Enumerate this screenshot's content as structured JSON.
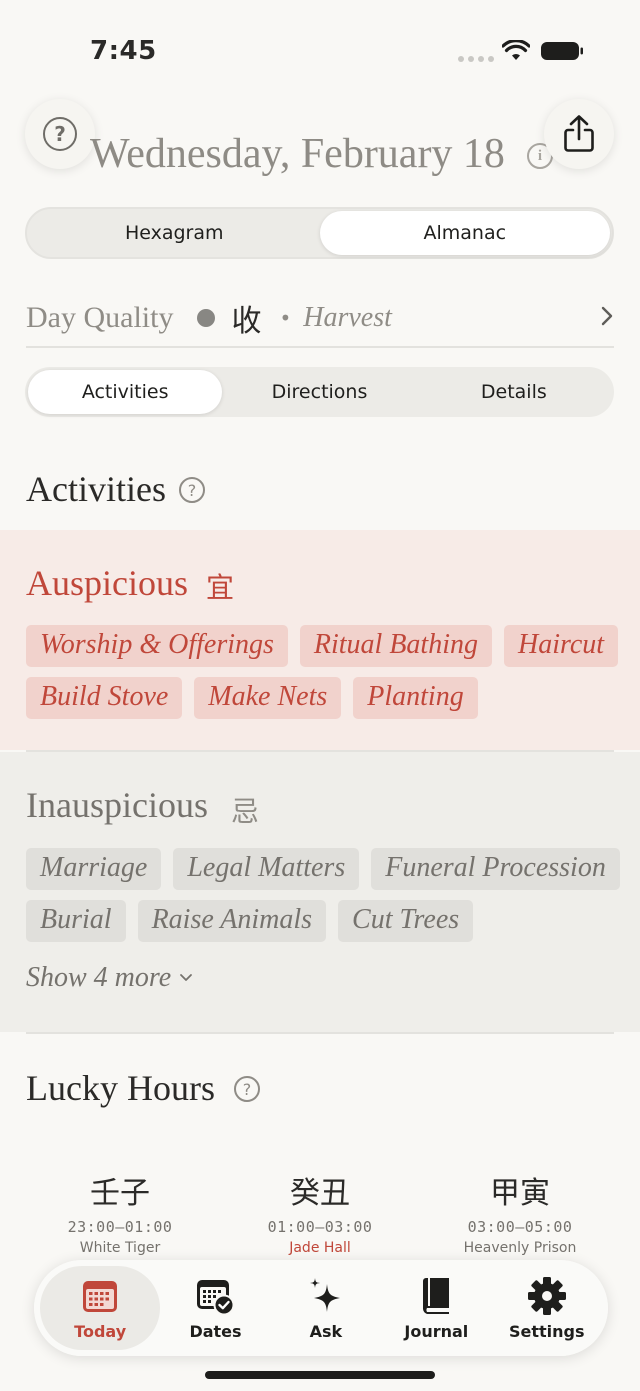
{
  "status_bar": {
    "time": "7:45"
  },
  "header": {
    "date": "Wednesday, February 18",
    "help_glyph": "?",
    "info_glyph": "i",
    "icons": {
      "help": "question-circle-icon",
      "share": "share-icon",
      "info": "info-icon"
    }
  },
  "mode_tabs": [
    {
      "label": "Hexagram",
      "active": false
    },
    {
      "label": "Almanac",
      "active": true
    }
  ],
  "day_quality": {
    "label": "Day Quality",
    "char": "收",
    "separator": "•",
    "meaning": "Harvest"
  },
  "sub_tabs": [
    {
      "label": "Activities",
      "active": true
    },
    {
      "label": "Directions",
      "active": false
    },
    {
      "label": "Details",
      "active": false
    }
  ],
  "activities": {
    "title": "Activities",
    "help_glyph": "?",
    "auspicious": {
      "title": "Auspicious",
      "char": "宜",
      "items": [
        "Worship & Offerings",
        "Ritual Bathing",
        "Haircut",
        "Build Stove",
        "Make Nets",
        "Planting"
      ]
    },
    "inauspicious": {
      "title": "Inauspicious",
      "char": "忌",
      "items": [
        "Marriage",
        "Legal Matters",
        "Funeral Procession",
        "Burial",
        "Raise Animals",
        "Cut Trees"
      ],
      "show_more": "Show 4 more"
    }
  },
  "lucky_hours": {
    "title": "Lucky Hours",
    "help_glyph": "?",
    "hours": [
      {
        "ganzhi": "壬子",
        "range": "23:00–01:00",
        "name": "White Tiger",
        "highlight": false
      },
      {
        "ganzhi": "癸丑",
        "range": "01:00–03:00",
        "name": "Jade Hall",
        "highlight": true
      },
      {
        "ganzhi": "甲寅",
        "range": "03:00–05:00",
        "name": "Heavenly Prison",
        "highlight": false
      }
    ]
  },
  "tab_bar": [
    {
      "label": "Today",
      "icon": "calendar-icon",
      "active": true
    },
    {
      "label": "Dates",
      "icon": "calendar-check-icon",
      "active": false
    },
    {
      "label": "Ask",
      "icon": "sparkles-icon",
      "active": false
    },
    {
      "label": "Journal",
      "icon": "book-icon",
      "active": false
    },
    {
      "label": "Settings",
      "icon": "gear-icon",
      "active": false
    }
  ],
  "colors": {
    "accent": "#c0473a",
    "auspicious_bg": "#f7ebe7",
    "inauspicious_bg": "#efeeea",
    "tag_good": "#f1d2cc",
    "tag_bad": "#e0dfdb"
  }
}
